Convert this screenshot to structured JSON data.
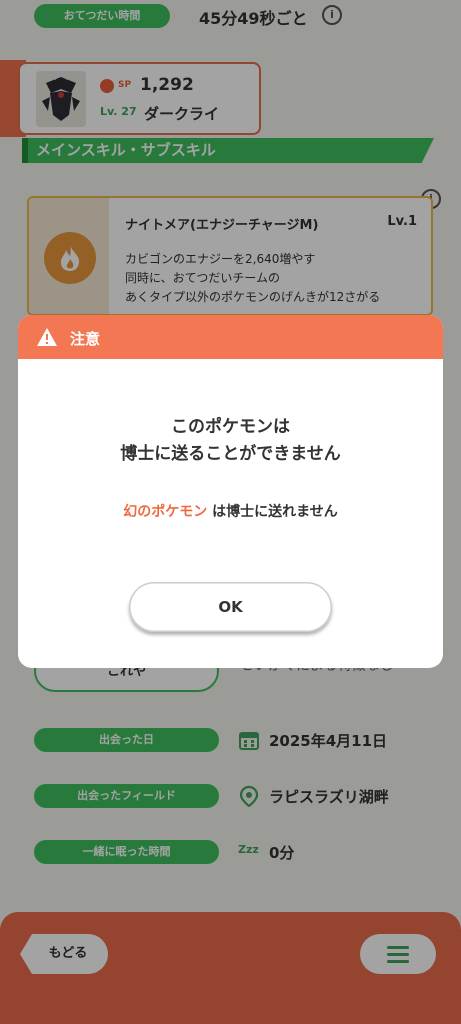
{
  "help_time": {
    "label": "おてつだい時間",
    "value": "45分49秒ごと"
  },
  "pokemon": {
    "sp_label": "SP",
    "sp_value": "1,292",
    "level": "Lv. 27",
    "name": "ダークライ"
  },
  "section_title": "メインスキル・サブスキル",
  "skill": {
    "name": "ナイトメア(エナジーチャージM)",
    "level": "Lv.1",
    "desc_line1": "カビゴンのエナジーを2,640増やす",
    "desc_line2": "同時に、おてつだいチームの",
    "desc_line3": "あくタイプ以外のポケモンのげんきが12さがる"
  },
  "hidden_row": {
    "button_text": "これや",
    "text": "せいかくによる特徴なし"
  },
  "met_date": {
    "label": "出会った日",
    "value": "2025年4月11日"
  },
  "met_field": {
    "label": "出会ったフィールド",
    "value": "ラピスラズリ湖畔"
  },
  "sleep_time": {
    "label": "一緒に眠った時間",
    "value": "0分"
  },
  "sleep_icon_text": "Zzz",
  "nav": {
    "back_label": "もどる"
  },
  "modal": {
    "title": "注意",
    "line1": "このポケモンは",
    "line2": "博士に送ることができません",
    "note_highlight": "幻のポケモン",
    "note_rest": " は博士に送れません",
    "ok_label": "OK"
  },
  "colors": {
    "accent_green": "#3fbf5f",
    "alert_orange": "#f47754",
    "bottom_bar": "#ea6b4b"
  }
}
